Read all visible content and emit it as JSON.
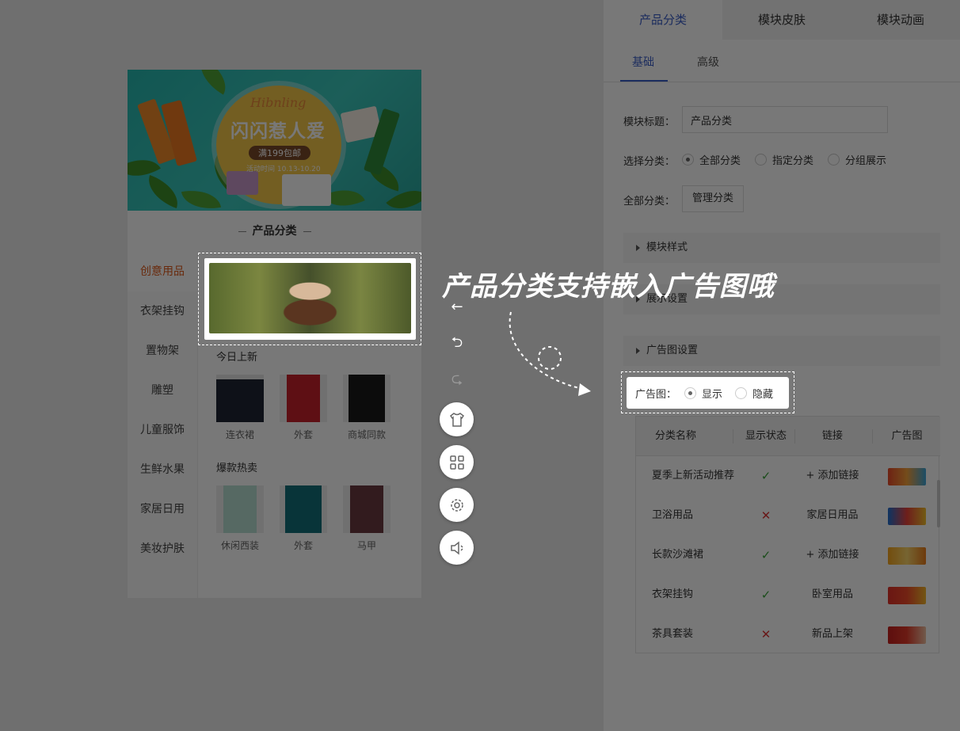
{
  "banner": {
    "script": "Hibnling",
    "title": "闪闪惹人爱",
    "chip": "满199包邮",
    "sub": "活动时间 10.13-10.20"
  },
  "phone": {
    "section_title": "产品分类",
    "categories": [
      "创意用品",
      "衣架挂钩",
      "置物架",
      "雕塑",
      "儿童服饰",
      "生鲜水果",
      "家居日用",
      "美妆护肤"
    ],
    "new_title": "今日上新",
    "new_items": [
      "连衣裙",
      "外套",
      "商城同款"
    ],
    "hot_title": "爆款热卖",
    "hot_items": [
      "休闲西装",
      "外套",
      "马甲"
    ]
  },
  "tools": {
    "arrows": [
      "←",
      "⮌",
      "⮎"
    ],
    "icons": [
      "shirt-icon",
      "grid-icon",
      "gear-icon",
      "speaker-icon"
    ]
  },
  "panel": {
    "top_tabs": [
      "产品分类",
      "模块皮肤",
      "模块动画"
    ],
    "sub_tabs": [
      "基础",
      "高级"
    ],
    "title_label": "模块标题：",
    "title_value": "产品分类",
    "select_label": "选择分类：",
    "select_options": [
      "全部分类",
      "指定分类",
      "分组展示"
    ],
    "all_label": "全部分类：",
    "manage_button": "管理分类",
    "sections": [
      "模块样式",
      "展示设置",
      "广告图设置"
    ],
    "ad_label": "广告图：",
    "ad_options": [
      "显示",
      "隐藏"
    ],
    "table": {
      "headers": [
        "分类名称",
        "显示状态",
        "链接",
        "广告图"
      ],
      "rows": [
        {
          "name": "夏季上新活动推荐",
          "status": "✓",
          "link": "+ 添加链接"
        },
        {
          "name": "卫浴用品",
          "status": "✕",
          "link": "家居日用品"
        },
        {
          "name": "长款沙滩裙",
          "status": "✓",
          "link": "+ 添加链接"
        },
        {
          "name": "衣架挂钩",
          "status": "✓",
          "link": "卧室用品"
        },
        {
          "name": "茶具套装",
          "status": "✕",
          "link": "新品上架"
        }
      ]
    }
  },
  "caption": "产品分类支持嵌入广告图哦",
  "colors": {
    "accent": "#3b5ec7",
    "active_category": "#e05a1a",
    "ok": "#3aa53a",
    "no": "#dd3333"
  }
}
